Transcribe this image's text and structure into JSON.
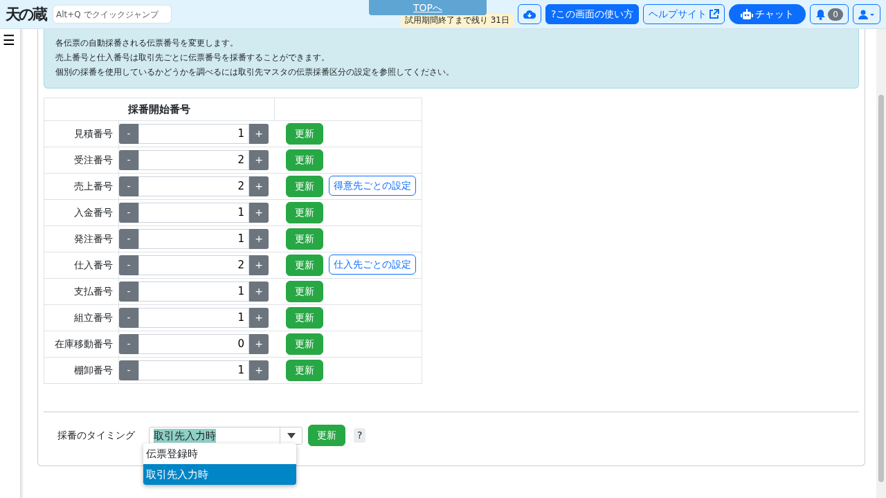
{
  "header": {
    "logo": "天の蔵",
    "jump_placeholder": "Alt+Q でクイックジャンプ",
    "top_link": "TOPへ",
    "trial": "試用期間終了まで残り 31日",
    "howto": "?この画面の使い方",
    "help_site": "ヘルプサイト",
    "chat": "チャット",
    "notifications": "0"
  },
  "sidebar": {
    "menu": "☰"
  },
  "notice": [
    "各伝票の自動採番される伝票番号を変更します。",
    "売上番号と仕入番号は取引先ごとに伝票番号を採番することができます。",
    "個別の採番を使用しているかどうかを調べるには取引先マスタの伝票採番区分の設定を参照してください。"
  ],
  "table": {
    "heading": "採番開始番号",
    "rows": [
      {
        "label": "見積番号",
        "minus": "-",
        "value": "1",
        "plus": "+",
        "update": "更新"
      },
      {
        "label": "受注番号",
        "minus": "-",
        "value": "2",
        "plus": "+",
        "update": "更新"
      },
      {
        "label": "売上番号",
        "minus": "-",
        "value": "2",
        "plus": "+",
        "update": "更新",
        "extra": "得意先ごとの設定"
      },
      {
        "label": "入金番号",
        "minus": "-",
        "value": "1",
        "plus": "+",
        "update": "更新"
      },
      {
        "label": "発注番号",
        "minus": "-",
        "value": "1",
        "plus": "+",
        "update": "更新"
      },
      {
        "label": "仕入番号",
        "minus": "-",
        "value": "2",
        "plus": "+",
        "update": "更新",
        "extra": "仕入先ごとの設定"
      },
      {
        "label": "支払番号",
        "minus": "-",
        "value": "1",
        "plus": "+",
        "update": "更新"
      },
      {
        "label": "組立番号",
        "minus": "-",
        "value": "1",
        "plus": "+",
        "update": "更新"
      },
      {
        "label": "在庫移動番号",
        "minus": "-",
        "value": "0",
        "plus": "+",
        "update": "更新"
      },
      {
        "label": "棚卸番号",
        "minus": "-",
        "value": "1",
        "plus": "+",
        "update": "更新"
      }
    ]
  },
  "timing": {
    "label": "採番のタイミング",
    "value": "取引先入力時",
    "update": "更新",
    "help": "?",
    "options": [
      {
        "label": "伝票登録時",
        "selected": false
      },
      {
        "label": "取引先入力時",
        "selected": true
      }
    ]
  }
}
